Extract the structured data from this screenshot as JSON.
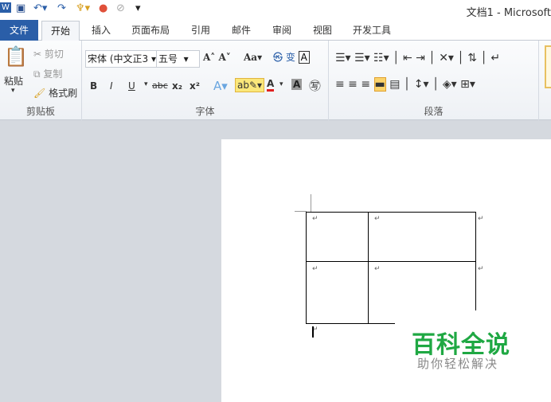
{
  "title": "文档1 - Microsoft",
  "tabs": {
    "file": "文件",
    "home": "开始",
    "insert": "插入",
    "layout": "页面布局",
    "references": "引用",
    "mailings": "邮件",
    "review": "审阅",
    "view": "视图",
    "developer": "开发工具"
  },
  "clipboard": {
    "paste": "粘贴",
    "cut": "剪切",
    "copy": "复制",
    "format_painter": "格式刷",
    "label": "剪贴板"
  },
  "font": {
    "name": "宋体 (中文正3",
    "size": "五号",
    "label": "字体",
    "case": "Aa",
    "bold": "B",
    "italic": "I",
    "underline": "U",
    "strike": "abc",
    "sub": "x₂",
    "sup": "x²"
  },
  "paragraph": {
    "label": "段落"
  },
  "table_marks": "↵",
  "watermark": {
    "title": "百科全说",
    "subtitle": "助你轻松解决"
  }
}
